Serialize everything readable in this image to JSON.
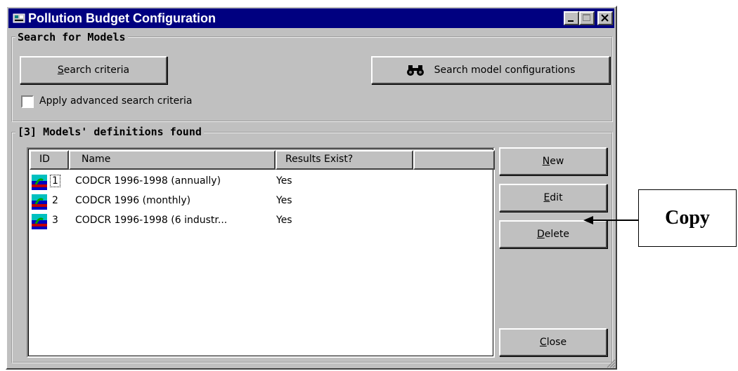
{
  "window": {
    "title": "Pollution Budget Configuration"
  },
  "search_group": {
    "legend": "Search for Models",
    "criteria_button_accesskey": "S",
    "criteria_button_rest": "earch criteria",
    "search_button_label": "Search model configurations",
    "advanced_label": "Apply advanced search criteria",
    "advanced_checked": false
  },
  "models_group": {
    "legend": "[3] Models' definitions found"
  },
  "table": {
    "columns": [
      "ID",
      "Name",
      "Results Exist?",
      ""
    ],
    "rows": [
      {
        "id": "1",
        "name": "CODCR 1996-1998 (annually)",
        "results": "Yes"
      },
      {
        "id": "2",
        "name": "CODCR 1996 (monthly)",
        "results": "Yes"
      },
      {
        "id": "3",
        "name": "CODCR 1996-1998 (6 industr...",
        "results": "Yes"
      }
    ]
  },
  "buttons": {
    "new": {
      "key": "N",
      "rest": "ew"
    },
    "edit": {
      "key": "E",
      "rest": "dit"
    },
    "delete": {
      "key": "D",
      "rest": "elete"
    },
    "close": {
      "key": "C",
      "rest": "lose"
    }
  },
  "annotation": {
    "label": "Copy"
  },
  "colors": {
    "titlebar": "#000080",
    "face": "#c0c0c0"
  }
}
